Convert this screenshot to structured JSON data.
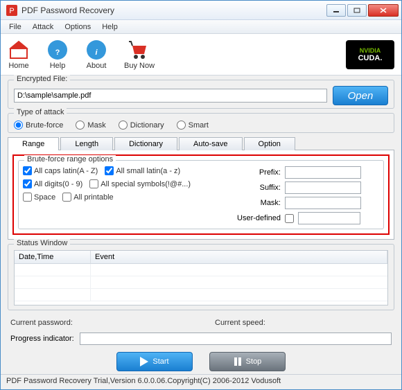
{
  "window": {
    "title": "PDF Password Recovery"
  },
  "menu": {
    "file": "File",
    "attack": "Attack",
    "options": "Options",
    "help": "Help"
  },
  "toolbar": {
    "home": "Home",
    "help": "Help",
    "about": "About",
    "buy": "Buy Now"
  },
  "cuda": {
    "brand": "NVIDIA",
    "label": "CUDA."
  },
  "file": {
    "group": "Encrypted File:",
    "path": "D:\\sample\\sample.pdf",
    "open": "Open"
  },
  "attack": {
    "group": "Type of attack",
    "brute": "Brute-force",
    "mask": "Mask",
    "dict": "Dictionary",
    "smart": "Smart"
  },
  "tabs": {
    "range": "Range",
    "length": "Length",
    "dict": "Dictionary",
    "auto": "Auto-save",
    "option": "Option"
  },
  "range": {
    "group": "Brute-force range options",
    "caps": "All caps latin(A - Z)",
    "small": "All small latin(a - z)",
    "digits": "All digits(0 - 9)",
    "symbols": "All special symbols(!@#...)",
    "space": "Space",
    "printable": "All printable",
    "prefix": "Prefix:",
    "suffix": "Suffix:",
    "maskl": "Mask:",
    "userdef": "User-defined"
  },
  "status": {
    "group": "Status Window",
    "col1": "Date,Time",
    "col2": "Event"
  },
  "info": {
    "curpass": "Current password:",
    "curspeed": "Current speed:",
    "prog": "Progress indicator:"
  },
  "buttons": {
    "start": "Start",
    "stop": "Stop"
  },
  "footer": {
    "text": "PDF Password Recovery Trial,Version 6.0.0.06.Copyright(C) 2006-2012 Vodusoft"
  }
}
